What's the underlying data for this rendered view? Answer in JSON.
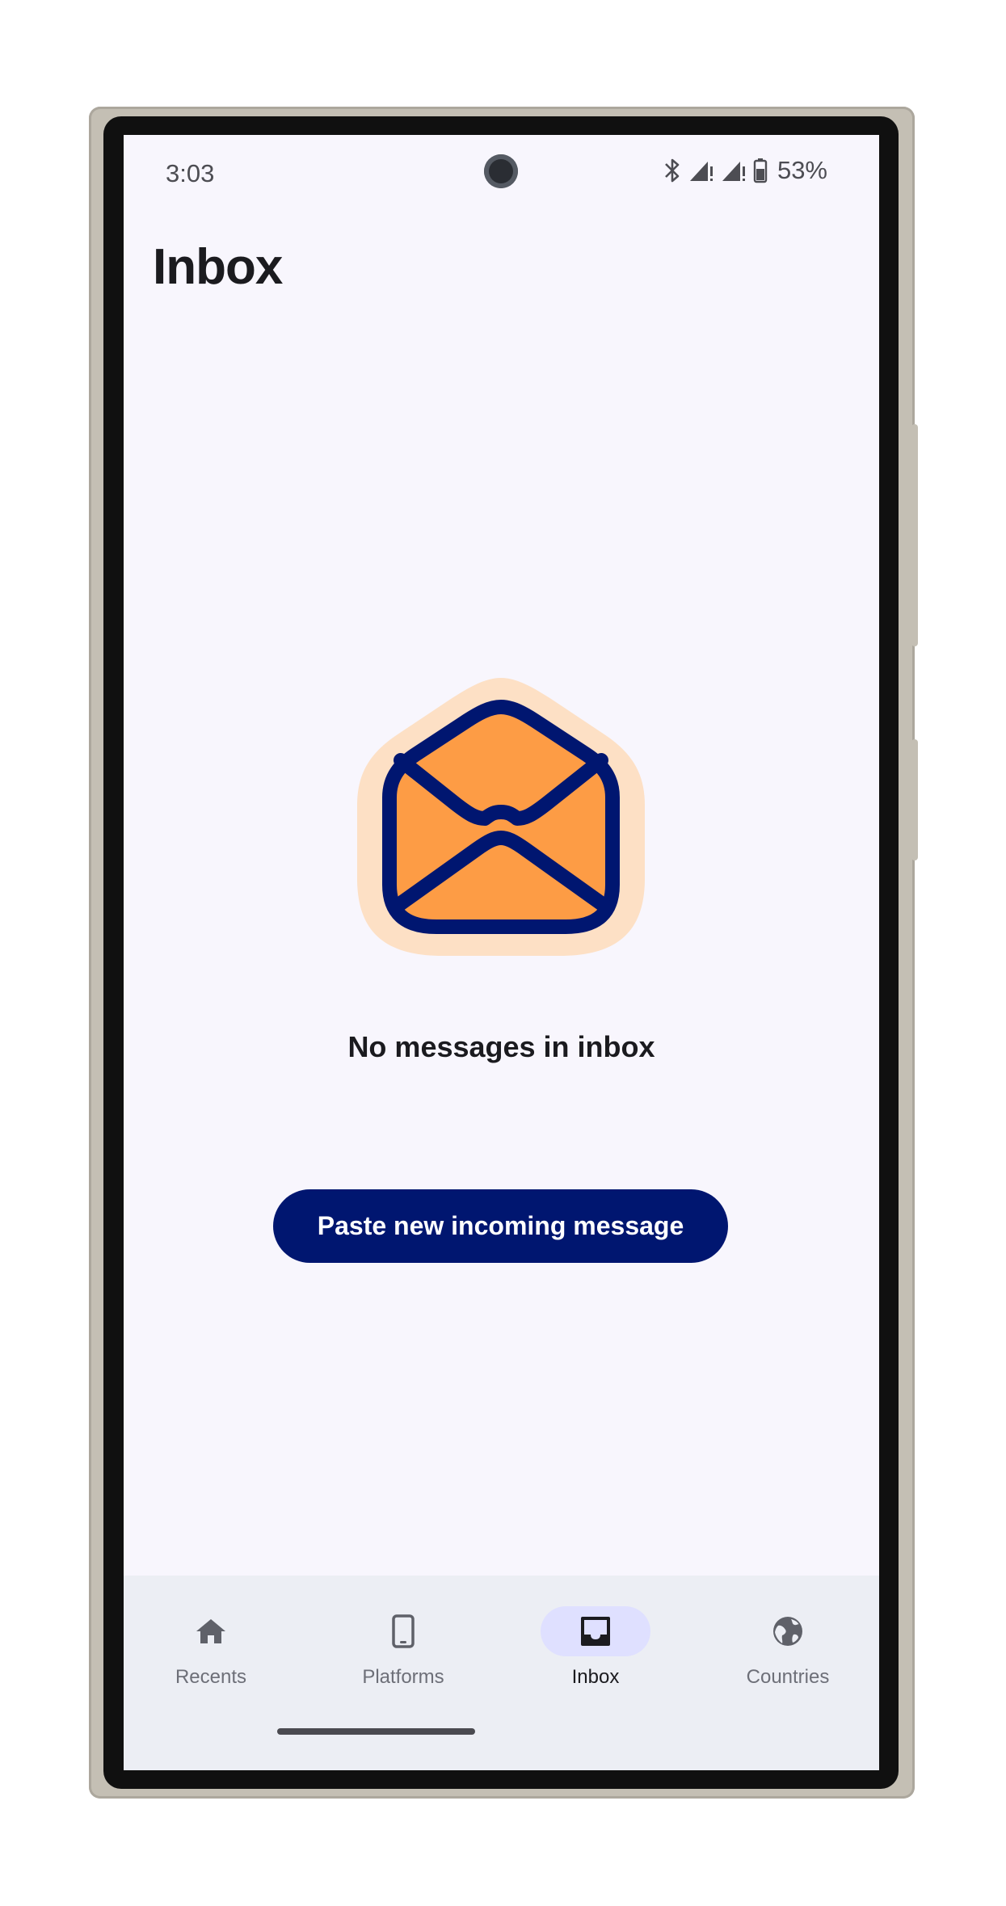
{
  "status_bar": {
    "time": "3:03",
    "battery": "53%",
    "icons": [
      "bluetooth-icon",
      "signal-icon",
      "signal-icon",
      "battery-icon"
    ]
  },
  "header": {
    "title": "Inbox"
  },
  "empty_state": {
    "icon": "open-envelope-icon",
    "message": "No messages in inbox"
  },
  "actions": {
    "paste_label": "Paste new incoming message"
  },
  "bottom_nav": {
    "items": [
      {
        "label": "Recents",
        "icon": "home-icon",
        "active": false
      },
      {
        "label": "Platforms",
        "icon": "phone-icon",
        "active": false
      },
      {
        "label": "Inbox",
        "icon": "inbox-icon",
        "active": true
      },
      {
        "label": "Countries",
        "icon": "globe-icon",
        "active": false
      }
    ]
  },
  "colors": {
    "background": "#f8f6fd",
    "primary": "#001670",
    "accent_orange": "#fd9c45",
    "accent_orange_light": "#fde0c5",
    "nav_background": "#eceef4",
    "nav_active_pill": "#dfe0ff"
  }
}
